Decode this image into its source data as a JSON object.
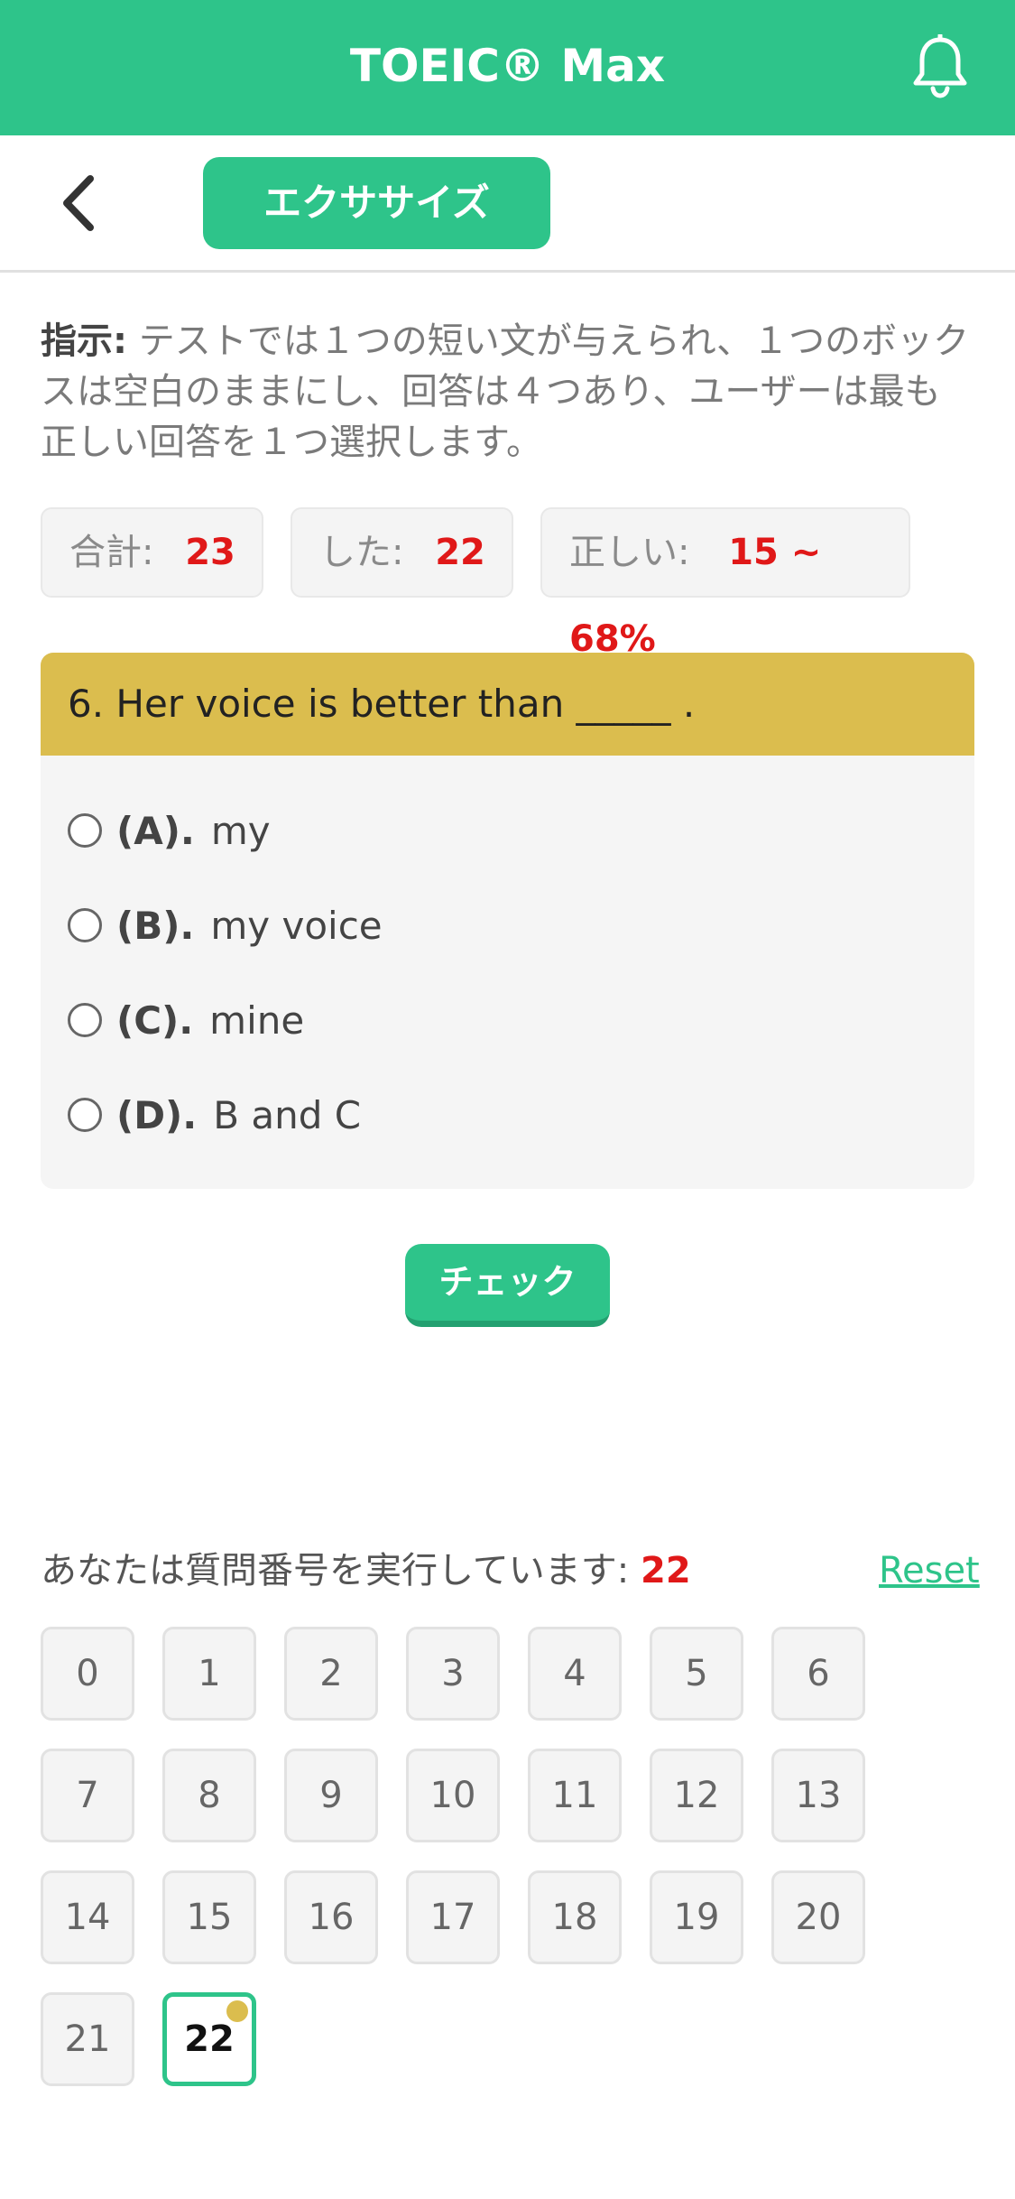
{
  "app": {
    "title": "TOEIC® Max"
  },
  "subbar": {
    "tab_label": "エクササイズ"
  },
  "instructions": {
    "label": "指示:",
    "text": " テストでは１つの短い文が与えられ、１つのボックスは空白のままにし、回答は４つあり、ユーザーは最も正しい回答を１つ選択します。"
  },
  "stats": {
    "total_label": "合計:",
    "total_value": "23",
    "done_label": "した:",
    "done_value": "22",
    "correct_label": "正しい:",
    "correct_value": "15 ~ 68%"
  },
  "question": {
    "text": "6. Her voice is better than _____ .",
    "options": [
      {
        "letter": "(A).",
        "text": "my"
      },
      {
        "letter": "(B).",
        "text": "my voice"
      },
      {
        "letter": "(C).",
        "text": "mine"
      },
      {
        "letter": "(D).",
        "text": "B and C"
      }
    ]
  },
  "check_label": "チェック",
  "progress": {
    "label": "あなたは質問番号を実行しています:",
    "current": "22",
    "reset_label": "Reset"
  },
  "question_numbers": [
    "0",
    "1",
    "2",
    "3",
    "4",
    "5",
    "6",
    "7",
    "8",
    "9",
    "10",
    "11",
    "12",
    "13",
    "14",
    "15",
    "16",
    "17",
    "18",
    "19",
    "20",
    "21",
    "22"
  ],
  "colors": {
    "brand": "#2ec48a",
    "question_header": "#dbbd4e",
    "highlight": "#e01818"
  },
  "icons": {
    "bell": "bell-icon",
    "back": "chevron-left-icon"
  }
}
